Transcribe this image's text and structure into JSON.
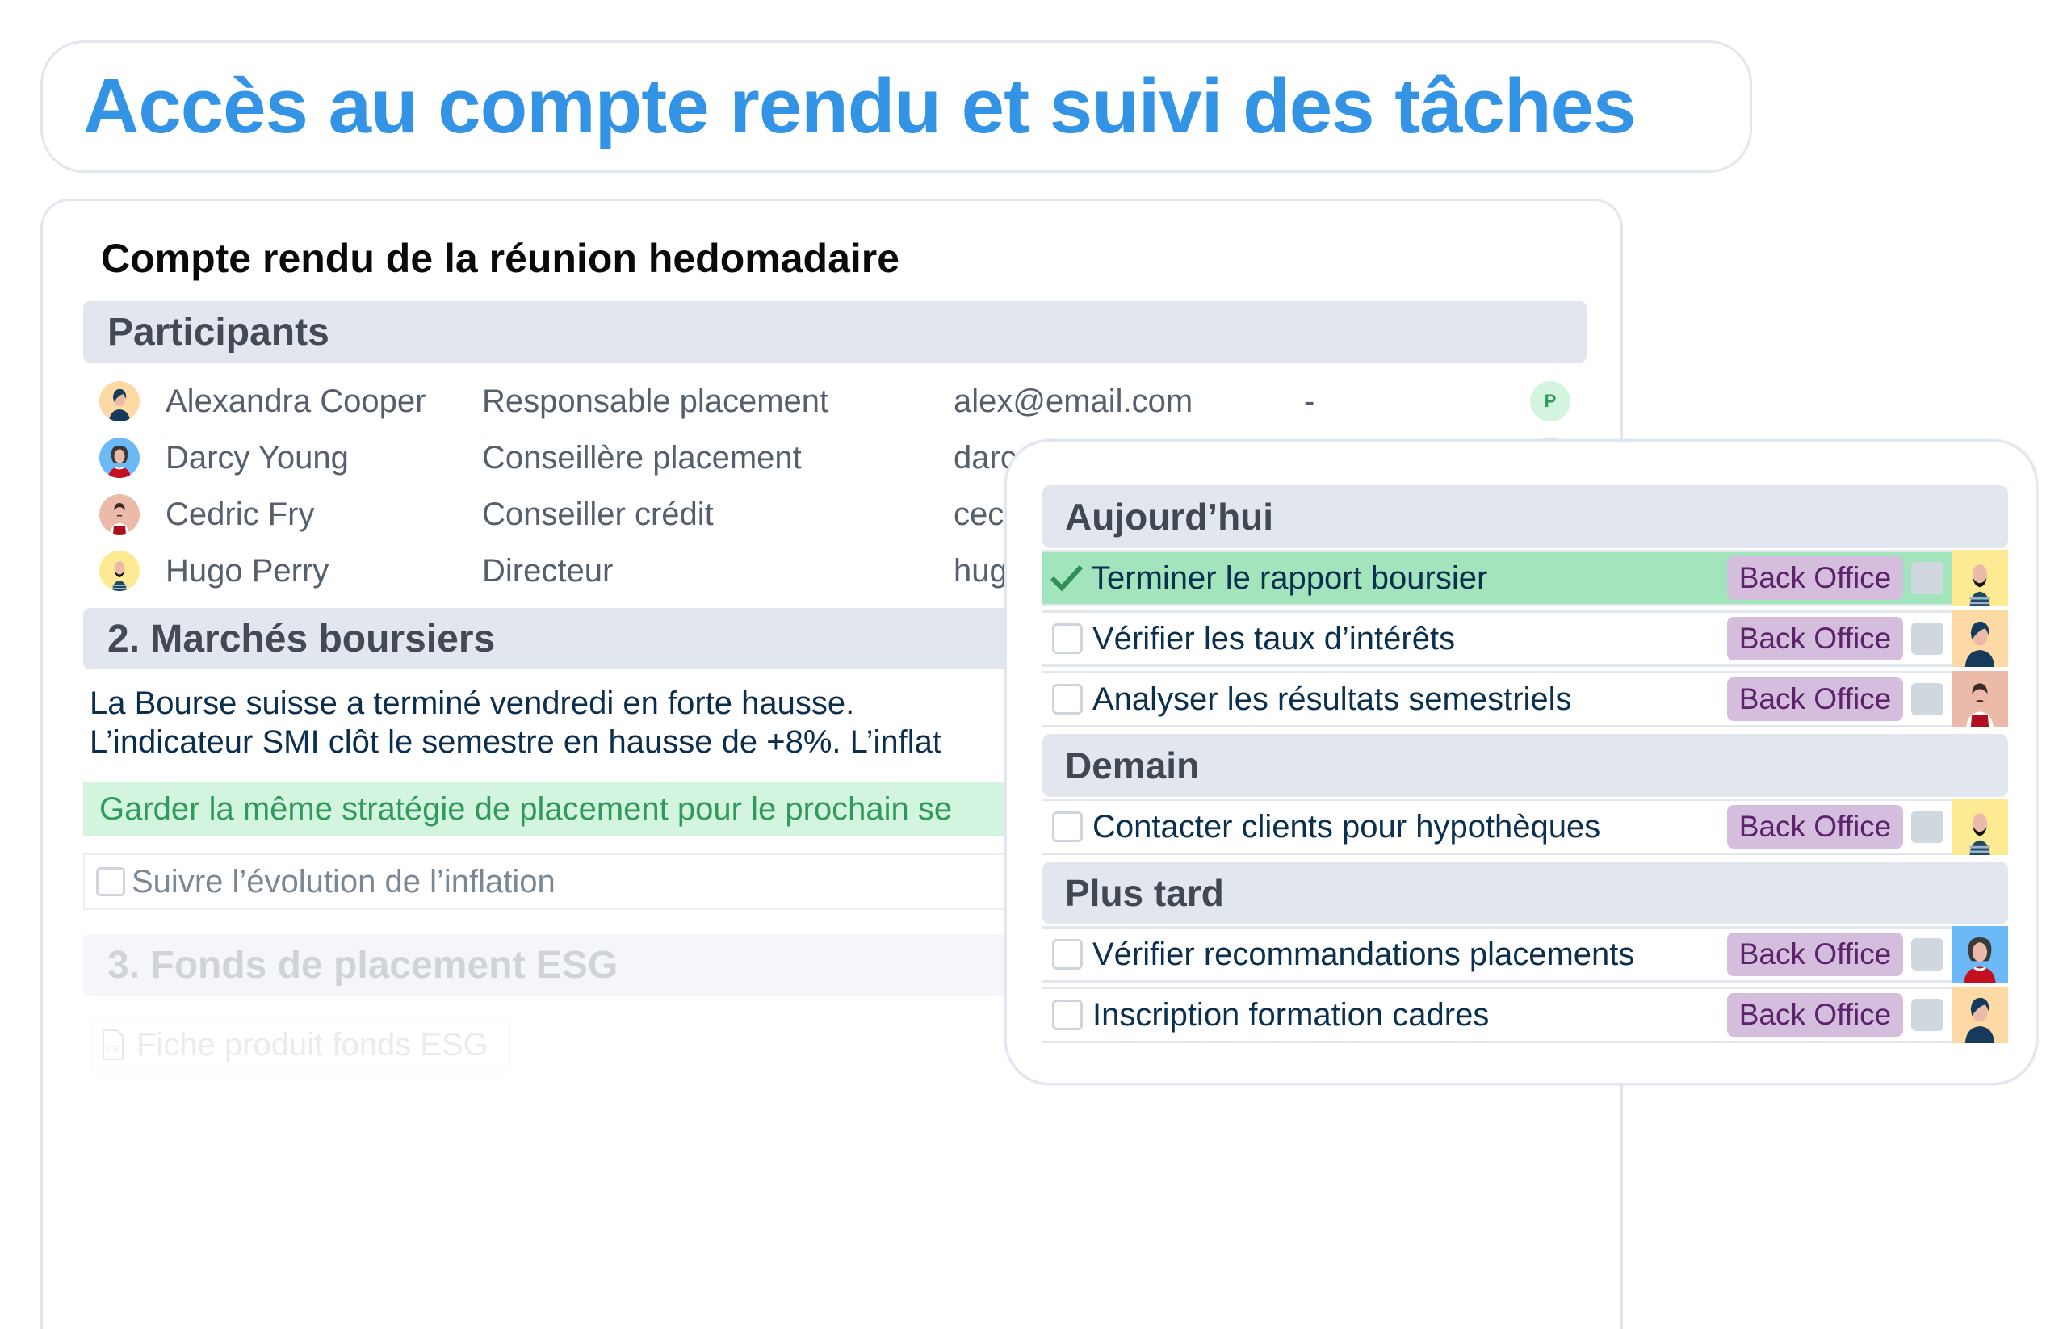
{
  "header": {
    "title": "Accès au compte rendu et suivi des tâches"
  },
  "document": {
    "title": "Compte rendu de la réunion hedomadaire",
    "participants_heading": "Participants",
    "participants": [
      {
        "name": "Alexandra Cooper",
        "role": "Responsable placement",
        "email": "alex@email.com",
        "extra": "-",
        "badge": "P",
        "avatar": "avatar-woman-short-hair",
        "avatar_bg": "#fdd9a4"
      },
      {
        "name": "Darcy Young",
        "role": "Conseillère placement",
        "email": "darc",
        "extra": "",
        "badge": "P",
        "avatar": "avatar-woman-curly-hair",
        "avatar_bg": "#6bb9f7"
      },
      {
        "name": "Cedric Fry",
        "role": "Conseiller crédit",
        "email": "cec",
        "extra": "",
        "badge": "",
        "avatar": "avatar-man-mustache",
        "avatar_bg": "#ebbaa9"
      },
      {
        "name": "Hugo Perry",
        "role": "Directeur",
        "email": "hug",
        "extra": "",
        "badge": "",
        "avatar": "avatar-man-beard",
        "avatar_bg": "#fdea92"
      }
    ],
    "section2": {
      "heading": "2. Marchés boursiers",
      "lines": [
        "La Bourse suisse a terminé vendredi en forte hausse.",
        "L’indicateur SMI clôt le semestre en hausse de +8%. L’inflat"
      ],
      "decision": "Garder la même stratégie de placement pour le prochain se",
      "todo": "Suivre l’évolution de l’inflation"
    },
    "section3": {
      "heading": "3. Fonds de placement ESG",
      "attachment": "Fiche produit fonds ESG",
      "attachment_icon": "pdf-file-icon"
    }
  },
  "tasks": {
    "tag_label": "Back Office",
    "groups": [
      {
        "title": "Aujourd’hui",
        "items": [
          {
            "label": "Terminer le rapport boursier",
            "done": true,
            "assignee": "Hugo Perry"
          },
          {
            "label": "Vérifier les taux d’intérêts",
            "done": false,
            "assignee": "Alexandra Cooper"
          },
          {
            "label": "Analyser les résultats semestriels",
            "done": false,
            "assignee": "Cedric Fry"
          }
        ]
      },
      {
        "title": "Demain",
        "items": [
          {
            "label": "Contacter clients pour hypothèques",
            "done": false,
            "assignee": "Hugo Perry"
          }
        ]
      },
      {
        "title": "Plus tard",
        "items": [
          {
            "label": "Vérifier recommandations placements",
            "done": false,
            "assignee": "Darcy Young"
          },
          {
            "label": "Inscription formation cadres",
            "done": false,
            "assignee": "Alexandra Cooper"
          }
        ]
      }
    ]
  },
  "colors": {
    "accent": "#3394e6",
    "done_row": "#a2e5bd",
    "tag_bg": "#d5bedd",
    "tag_text": "#5b2369",
    "decision_bg": "#d3f5e0",
    "decision_text": "#2f9a5c",
    "section_bg": "#e2e6ee"
  }
}
